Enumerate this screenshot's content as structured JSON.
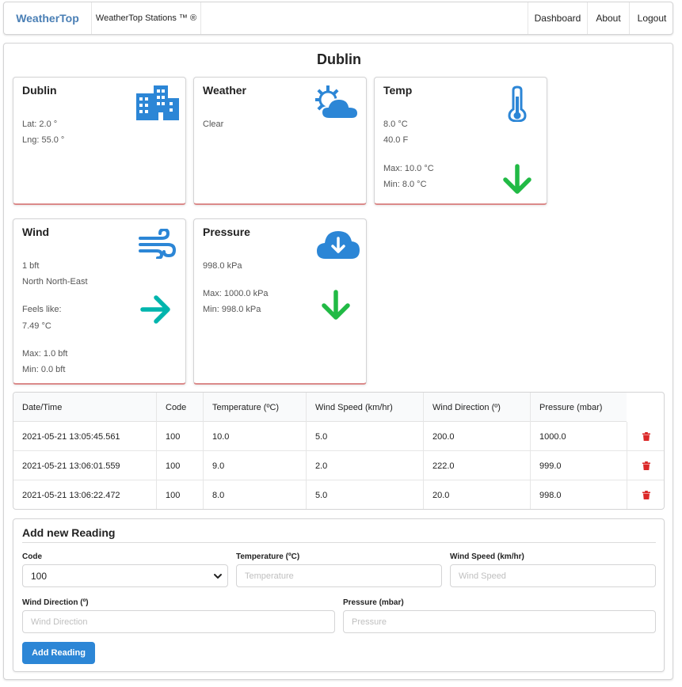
{
  "nav": {
    "brand": "WeatherTop",
    "stations": "WeatherTop Stations ™ ®",
    "dashboard": "Dashboard",
    "about": "About",
    "logout": "Logout"
  },
  "page_title": "Dublin",
  "cards": {
    "station": {
      "title": "Dublin",
      "lat": "Lat: 2.0 °",
      "lng": "Lng: 55.0 °",
      "icon": "building-icon"
    },
    "weather": {
      "title": "Weather",
      "condition": "Clear",
      "icon": "sun-cloud-icon"
    },
    "temp": {
      "title": "Temp",
      "celsius": "8.0 °C",
      "fahrenheit": "40.0 F",
      "max": "Max: 10.0 °C",
      "min": "Min: 8.0 °C",
      "icon": "thermometer-icon",
      "trend": "arrow-down-icon"
    },
    "wind": {
      "title": "Wind",
      "speed": "1 bft",
      "direction": "North North-East",
      "feels_label": "Feels like:",
      "feels_value": "7.49 °C",
      "max": "Max: 1.0 bft",
      "min": "Min: 0.0 bft",
      "icon": "wind-icon",
      "trend": "arrow-right-icon"
    },
    "pressure": {
      "title": "Pressure",
      "value": "998.0 kPa",
      "max": "Max: 1000.0 kPa",
      "min": "Min: 998.0 kPa",
      "icon": "cloud-download-icon",
      "trend": "arrow-down-icon"
    }
  },
  "colors": {
    "brand": "#4a7fb5",
    "icon_blue": "#2c86d6",
    "trend_green": "#21ba45",
    "trend_teal": "#00b5ad",
    "delete_red": "#db2828",
    "button": "#2c86d6"
  },
  "table": {
    "headers": [
      "Date/Time",
      "Code",
      "Temperature (ºC)",
      "Wind Speed (km/hr)",
      "Wind Direction (º)",
      "Pressure (mbar)"
    ],
    "rows": [
      [
        "2021-05-21 13:05:45.561",
        "100",
        "10.0",
        "5.0",
        "200.0",
        "1000.0"
      ],
      [
        "2021-05-21 13:06:01.559",
        "100",
        "9.0",
        "2.0",
        "222.0",
        "999.0"
      ],
      [
        "2021-05-21 13:06:22.472",
        "100",
        "8.0",
        "5.0",
        "20.0",
        "998.0"
      ]
    ],
    "row_action_icon": "trash-icon"
  },
  "form": {
    "title": "Add new Reading",
    "code_label": "Code",
    "code_value": "100",
    "temperature_label": "Temperature (ºC)",
    "temperature_placeholder": "Temperature",
    "wind_speed_label": "Wind Speed (km/hr)",
    "wind_speed_placeholder": "Wind Speed",
    "wind_direction_label": "Wind Direction (º)",
    "wind_direction_placeholder": "Wind Direction",
    "pressure_label": "Pressure (mbar)",
    "pressure_placeholder": "Pressure",
    "submit_label": "Add Reading"
  }
}
